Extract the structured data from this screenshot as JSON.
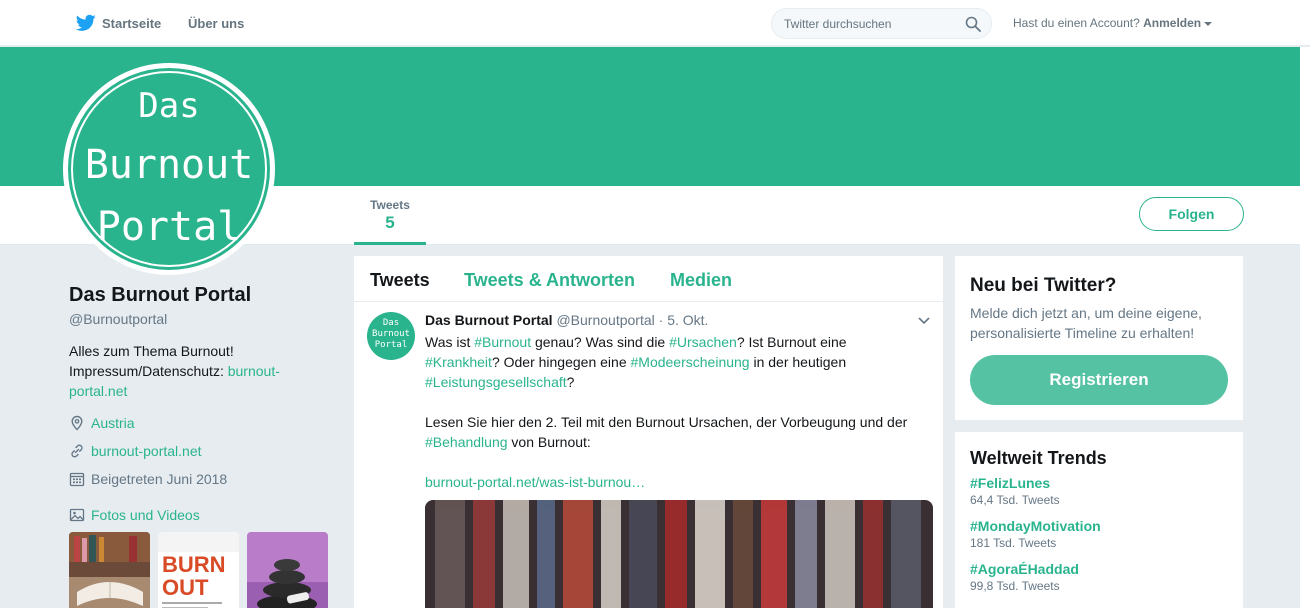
{
  "nav": {
    "home_label": "Startseite",
    "about_label": "Über uns",
    "search_placeholder": "Twitter durchsuchen",
    "account_prompt": "Hast du einen Account?",
    "login_label": "Anmelden"
  },
  "profile": {
    "avatar_lines": [
      "Das",
      "Burnout",
      "Portal"
    ],
    "name": "Das Burnout Portal",
    "handle": "@Burnoutportal",
    "bio_line1": "Alles zum Thema Burnout!",
    "bio_line2_prefix": "Impressum/Datenschutz:",
    "bio_link": "burnout-portal.net",
    "location": "Austria",
    "website": "burnout-portal.net",
    "joined": "Beigetreten Juni 2018",
    "media_label": "Fotos und Videos"
  },
  "stats": {
    "tweets_label": "Tweets",
    "tweets_count": "5"
  },
  "follow_label": "Folgen",
  "timeline": {
    "tabs": [
      "Tweets",
      "Tweets & Antworten",
      "Medien"
    ],
    "tweet": {
      "avatar_text": "Das Burnout Portal",
      "author": "Das Burnout Portal",
      "handle": "@Burnoutportal",
      "date": "· 5. Okt.",
      "link": "burnout-portal.net/was-ist-burnou…"
    }
  },
  "signup": {
    "title": "Neu bei Twitter?",
    "text": "Melde dich jetzt an, um deine eigene, personalisierte Timeline zu erhalten!",
    "button": "Registrieren"
  },
  "trends": {
    "title": "Weltweit Trends",
    "items": [
      {
        "name": "#FelizLunes",
        "count": "64,4 Tsd. Tweets"
      },
      {
        "name": "#MondayMotivation",
        "count": "181 Tsd. Tweets"
      },
      {
        "name": "#AgoraÉHaddad",
        "count": "99,8 Tsd. Tweets"
      }
    ]
  },
  "colors": {
    "accent": "#2ab48e",
    "background": "#e6ecf0"
  }
}
